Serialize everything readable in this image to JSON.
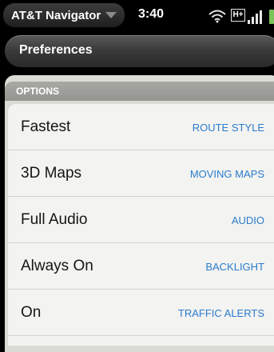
{
  "status_bar": {
    "app_name": "AT&T Navigator",
    "time": "3:40",
    "network": "H+",
    "icons": [
      "chevron-down-icon",
      "wifi-icon",
      "network-type-icon",
      "signal-icon",
      "battery-icon"
    ],
    "battery_color": "#7ac35a"
  },
  "header": {
    "title": "Preferences"
  },
  "section": {
    "label": "OPTIONS"
  },
  "items": [
    {
      "value": "Fastest",
      "label": "ROUTE STYLE"
    },
    {
      "value": "3D Maps",
      "label": "MOVING MAPS"
    },
    {
      "value": "Full Audio",
      "label": "AUDIO"
    },
    {
      "value": "Always On",
      "label": "BACKLIGHT"
    },
    {
      "value": "On",
      "label": "TRAFFIC ALERTS"
    }
  ],
  "colors": {
    "accent_blue": "#2b7ccd",
    "list_bg": "#f3f3f1",
    "section_header_bg": "#9e9e9a"
  }
}
